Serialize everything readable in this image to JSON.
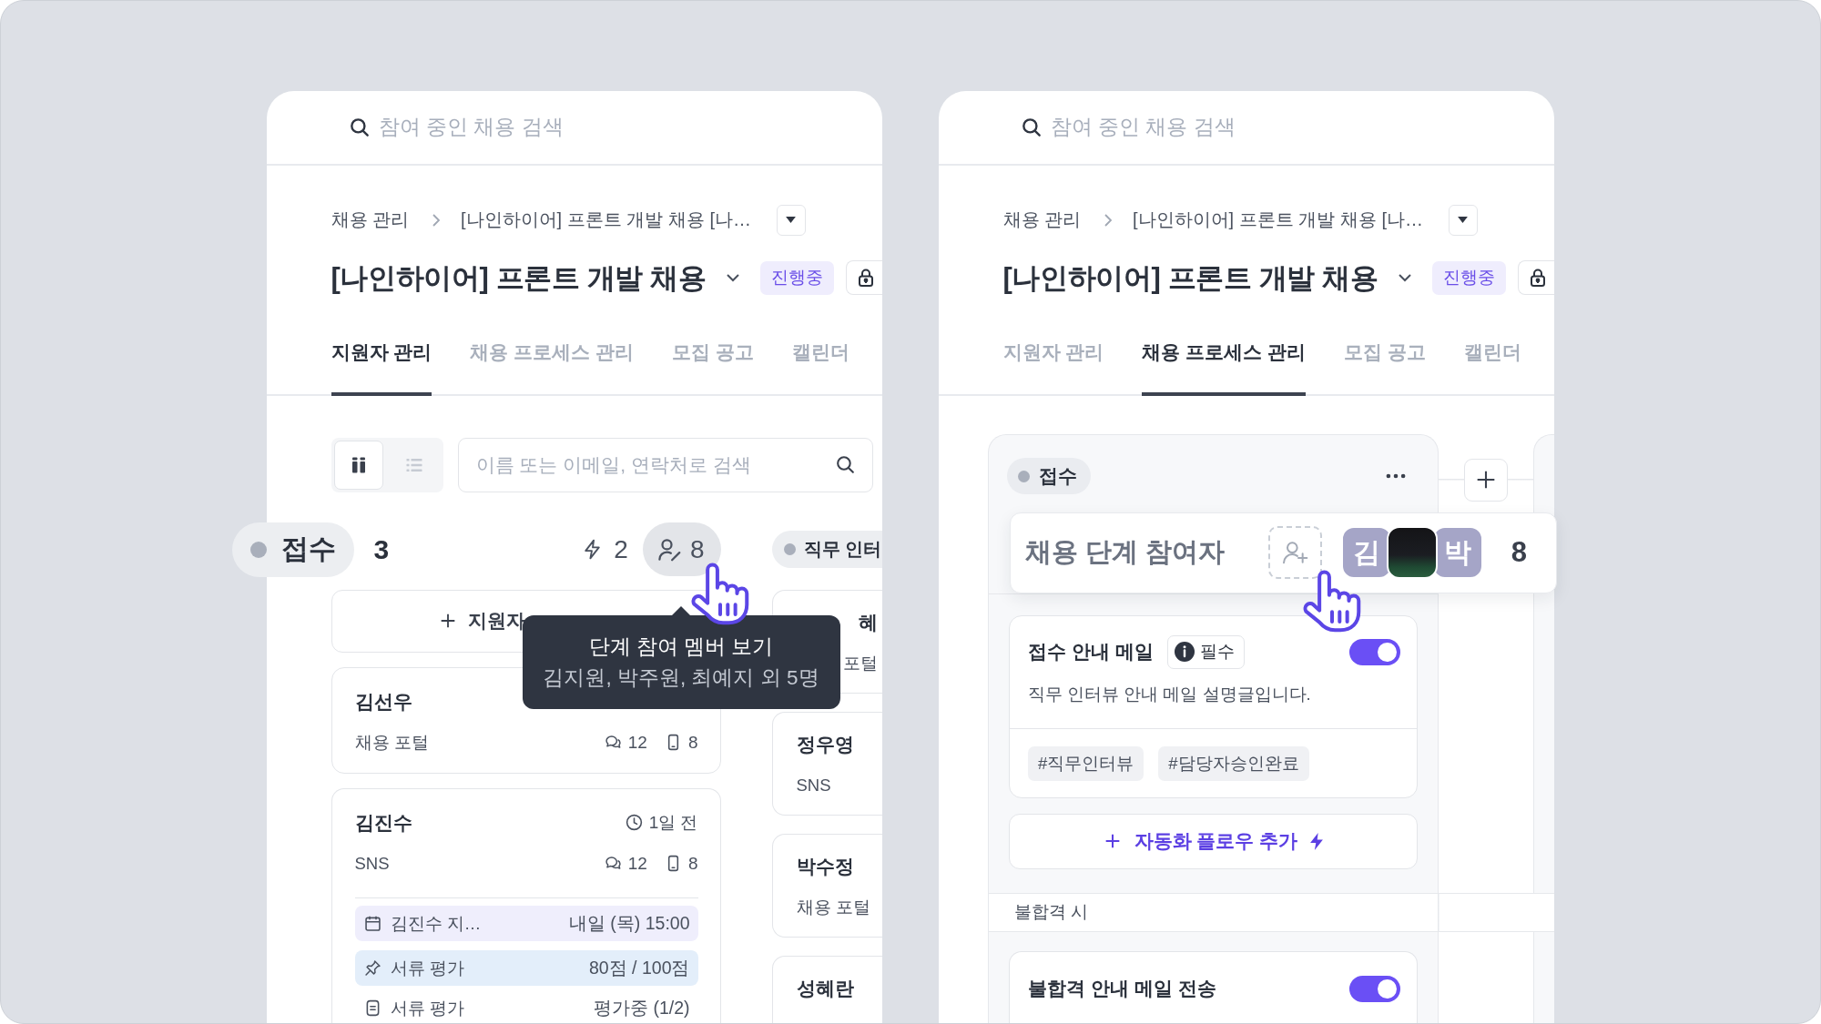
{
  "panels": [
    {
      "kind": "applicants",
      "search": {
        "placeholder": "참여 중인 채용 검색"
      },
      "breadcrumb": [
        "채용 관리",
        "[나인하이어] 프론트 개발 채용 [나…"
      ],
      "title": "[나인하이어] 프론트 개발 채용",
      "status_badge": "진행중",
      "tabs": [
        {
          "label": "지원자 관리",
          "selected": true
        },
        {
          "label": "채용 프로세스 관리",
          "selected": false
        },
        {
          "label": "모집 공고",
          "selected": false
        },
        {
          "label": "캘린더",
          "selected": false
        }
      ],
      "board": {
        "view_toggle": [
          {
            "kind": "board",
            "selected": true
          },
          {
            "kind": "list",
            "selected": false
          }
        ],
        "search": {
          "placeholder": "이름 또는 이메일, 연락처로 검색"
        },
        "columns": [
          {
            "name": "접수",
            "highlighted": true,
            "count": "3",
            "automations": "2",
            "members": "8",
            "members_tooltip": {
              "title": "단계 참여 멤버 보기",
              "text": "김지원, 박주원, 최예지 외 5명"
            },
            "add_button": "지원자",
            "cards": [
              {
                "name": "김선우",
                "source": "채용 포털",
                "comments": "12",
                "phones": "8",
                "name_covered": false
              },
              {
                "name": "김진수",
                "time": "1일 전",
                "source": "SNS",
                "comments": "12",
                "phones": "8",
                "name_covered": false,
                "items": [
                  {
                    "kind": "schedule",
                    "label": "김진수 지…",
                    "value": "내일 (목) 15:00"
                  },
                  {
                    "kind": "evaluation",
                    "label": "서류 평가",
                    "value": "80점 / 100점"
                  },
                  {
                    "kind": "document",
                    "label": "서류 평가",
                    "value": "평가중 (1/2)"
                  }
                ]
              }
            ]
          },
          {
            "name": "직무 인터",
            "highlighted": false,
            "cards": [
              {
                "name": "혜",
                "source": "포털",
                "name_covered": true
              },
              {
                "name": "정우영",
                "source": "SNS",
                "name_covered": false
              },
              {
                "name": "박수정",
                "source": "채용 포털",
                "name_covered": false
              },
              {
                "name": "성혜란",
                "name_covered": false
              }
            ]
          }
        ]
      }
    },
    {
      "kind": "process",
      "search": {
        "placeholder": "참여 중인 채용 검색"
      },
      "breadcrumb": [
        "채용 관리",
        "[나인하이어] 프론트 개발 채용 [나…"
      ],
      "title": "[나인하이어] 프론트 개발 채용",
      "status_badge": "진행중",
      "tabs": [
        {
          "label": "지원자 관리",
          "selected": false
        },
        {
          "label": "채용 프로세스 관리",
          "selected": true
        },
        {
          "label": "모집 공고",
          "selected": false
        },
        {
          "label": "캘린더",
          "selected": false
        }
      ],
      "stage": {
        "name": "접수",
        "participants": {
          "title": "채용 단계 참여자",
          "avatars": [
            {
              "kind": "initial",
              "text": "김"
            },
            {
              "kind": "photo"
            },
            {
              "kind": "initial",
              "text": "박"
            }
          ],
          "count": "8"
        },
        "automations": [
          {
            "title": "접수 안내 메일",
            "badge": "필수",
            "on": true,
            "description": "직무 인터뷰 안내 메일 설명글입니다.",
            "tags": [
              "#직무인터뷰",
              "#담당자승인완료"
            ]
          }
        ],
        "add_flow": "자동화 플로우 추가",
        "fail_section": {
          "label": "불합격 시",
          "automations": [
            {
              "title": "불합격 안내 메일 전송",
              "on": true
            }
          ]
        }
      }
    }
  ]
}
